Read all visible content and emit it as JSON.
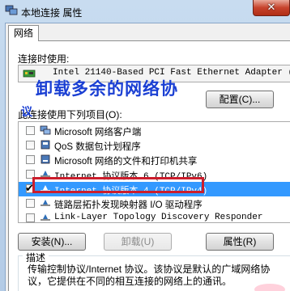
{
  "window": {
    "title": "本地连接 属性",
    "close_glyph": "✕"
  },
  "tabs": [
    {
      "label": "网络"
    }
  ],
  "connect_using": {
    "label": "连接时使用:",
    "adapter": "Intel 21140-Based PCI Fast Ethernet Adapter (",
    "configure_button": "配置(C)..."
  },
  "overlay_text": {
    "line1": "卸载多余的网络协",
    "line2": "议"
  },
  "items_section": {
    "label": "此连接使用下列项目(O):",
    "items": [
      {
        "label": "Microsoft 网络客户端",
        "checked": false,
        "icon": "network-client-icon"
      },
      {
        "label": "QoS 数据包计划程序",
        "checked": false,
        "icon": "qos-icon"
      },
      {
        "label": "Microsoft 网络的文件和打印机共享",
        "checked": false,
        "icon": "file-share-icon"
      },
      {
        "label": "Internet 协议版本 6 (TCP/IPv6)",
        "checked": false,
        "icon": "protocol-icon"
      },
      {
        "label": "Internet 协议版本 4 (TCP/IPv4)",
        "checked": true,
        "selected": true,
        "icon": "protocol-icon"
      },
      {
        "label": "链路层拓扑发现映射器 I/O 驱动程序",
        "checked": false,
        "icon": "protocol-icon"
      },
      {
        "label": "Link-Layer Topology Discovery Responder",
        "checked": false,
        "icon": "protocol-icon"
      }
    ]
  },
  "buttons": {
    "install": "安装(N)...",
    "uninstall": "卸载(U)",
    "properties": "属性(R)"
  },
  "description": {
    "title": "描述",
    "text": "传输控制协议/Internet 协议。该协议是默认的广域网络协议，它提供在不同的相互连接的网络上的通讯。"
  },
  "colors": {
    "selection": "#3399ff",
    "highlight_border": "#cc1d2c",
    "overlay_text": "#1a3fd3"
  }
}
